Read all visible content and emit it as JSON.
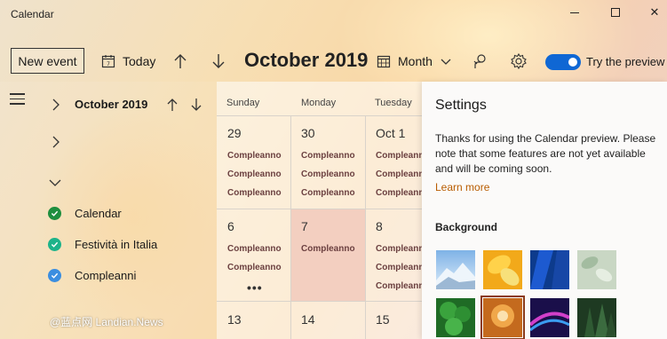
{
  "app": {
    "title": "Calendar"
  },
  "window_controls": {
    "minimize": "minimize",
    "maximize": "maximize",
    "close": "✕"
  },
  "toolbar": {
    "new_event_label": "New event",
    "today_label": "Today",
    "month_title": "October 2019",
    "view_label": "Month",
    "preview_label": "Try the preview",
    "preview_enabled": true
  },
  "sidebar": {
    "mini_calendar_title": "October 2019",
    "calendars": [
      {
        "label": "Calendar",
        "color": "#1e8e3e"
      },
      {
        "label": "Festività in Italia",
        "color": "#1db38a"
      },
      {
        "label": "Compleanni",
        "color": "#3b8ee0"
      }
    ]
  },
  "grid": {
    "day_headers": [
      "Sunday",
      "Monday",
      "Tuesday"
    ],
    "week1": {
      "dates": [
        "29",
        "30",
        "Oct 1"
      ],
      "events": [
        [
          "Compleanno",
          "Compleanno",
          "Compleanno"
        ],
        [
          "Compleanno",
          "Compleanno",
          "Compleanno"
        ],
        [
          "Compleanno",
          "Compleanno",
          "Compleanno"
        ]
      ]
    },
    "week2": {
      "dates": [
        "6",
        "7",
        "8"
      ],
      "sunday_events": [
        "Compleanno",
        "Compleanno"
      ],
      "monday_events": [
        "Compleanno"
      ],
      "tuesday_events": [
        "Compleanno",
        "Compleanno",
        "Compleanno"
      ],
      "more": "•••"
    },
    "week3": {
      "dates": [
        "13",
        "14",
        "15"
      ]
    }
  },
  "settings": {
    "title": "Settings",
    "description": "Thanks for using the Calendar preview. Please note that some features are not yet available and will be coming soon.",
    "learn_more": "Learn more",
    "background_label": "Background",
    "backgrounds": [
      {
        "name": "mountain",
        "selected": false
      },
      {
        "name": "yellow-leaves",
        "selected": false
      },
      {
        "name": "blue-building",
        "selected": false
      },
      {
        "name": "pale-leaves",
        "selected": false
      },
      {
        "name": "green-clover",
        "selected": false
      },
      {
        "name": "orange-flower",
        "selected": true
      },
      {
        "name": "purple-lights",
        "selected": false
      },
      {
        "name": "forest",
        "selected": false
      }
    ]
  },
  "watermark": {
    "text": "@蓝点网 Landian.News"
  },
  "colors": {
    "accent": "#0f67d4",
    "link": "#b85c00",
    "highlight_cell": "#f3cfc0"
  }
}
